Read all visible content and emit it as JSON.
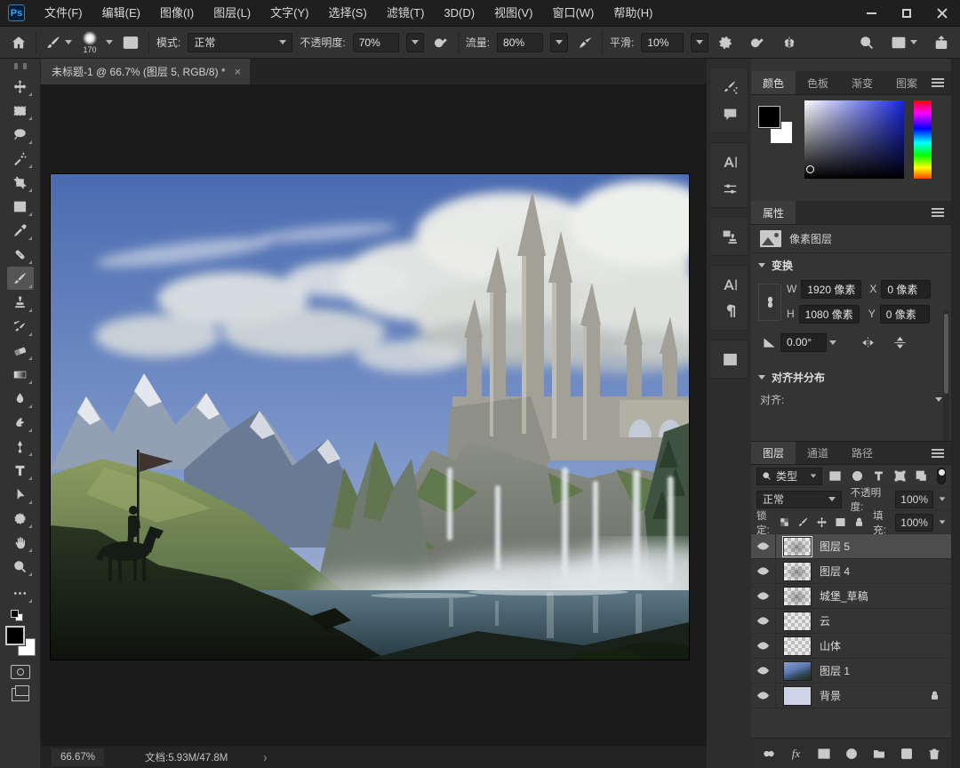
{
  "titlebar": {
    "logo": "Ps",
    "menus": [
      "文件(F)",
      "编辑(E)",
      "图像(I)",
      "图层(L)",
      "文字(Y)",
      "选择(S)",
      "滤镜(T)",
      "3D(D)",
      "视图(V)",
      "窗口(W)",
      "帮助(H)"
    ]
  },
  "options": {
    "brush_size": "170",
    "mode_label": "模式:",
    "mode_value": "正常",
    "opacity_label": "不透明度:",
    "opacity_value": "70%",
    "flow_label": "流量:",
    "flow_value": "80%",
    "smoothing_label": "平滑:",
    "smoothing_value": "10%"
  },
  "tab": {
    "title": "未标题-1 @ 66.7% (图层 5, RGB/8) *",
    "close": "×"
  },
  "color_panel": {
    "tabs": [
      "颜色",
      "色板",
      "渐变",
      "图案"
    ]
  },
  "properties": {
    "tab": "属性",
    "layer_kind": "像素图层",
    "transform_section": "变换",
    "w_label": "W",
    "w_value": "1920 像素",
    "x_label": "X",
    "x_value": "0 像素",
    "h_label": "H",
    "h_value": "1080 像素",
    "y_label": "Y",
    "y_value": "0 像素",
    "angle_value": "0.00°",
    "align_section": "对齐并分布",
    "align_label": "对齐:"
  },
  "layers_panel": {
    "tabs": [
      "图层",
      "通道",
      "路径"
    ],
    "filter_value": "类型",
    "blend_value": "正常",
    "opacity_label": "不透明度:",
    "opacity_value": "100%",
    "lock_label": "锁定:",
    "fill_label": "填充:",
    "fill_value": "100%",
    "fx_label": "fx",
    "items": [
      {
        "name": "图层 5"
      },
      {
        "name": "图层 4"
      },
      {
        "name": "城堡_草稿"
      },
      {
        "name": "云"
      },
      {
        "name": "山体"
      },
      {
        "name": "图层 1"
      },
      {
        "name": "背景"
      }
    ]
  },
  "statusbar": {
    "zoom": "66.67%",
    "doc_info": "文档:5.93M/47.8M"
  },
  "colors": {
    "foreground": "#000000",
    "background": "#ffffff",
    "selected_layer_bg": "#4d4d4d",
    "accent_logo": "#31a8ff"
  }
}
